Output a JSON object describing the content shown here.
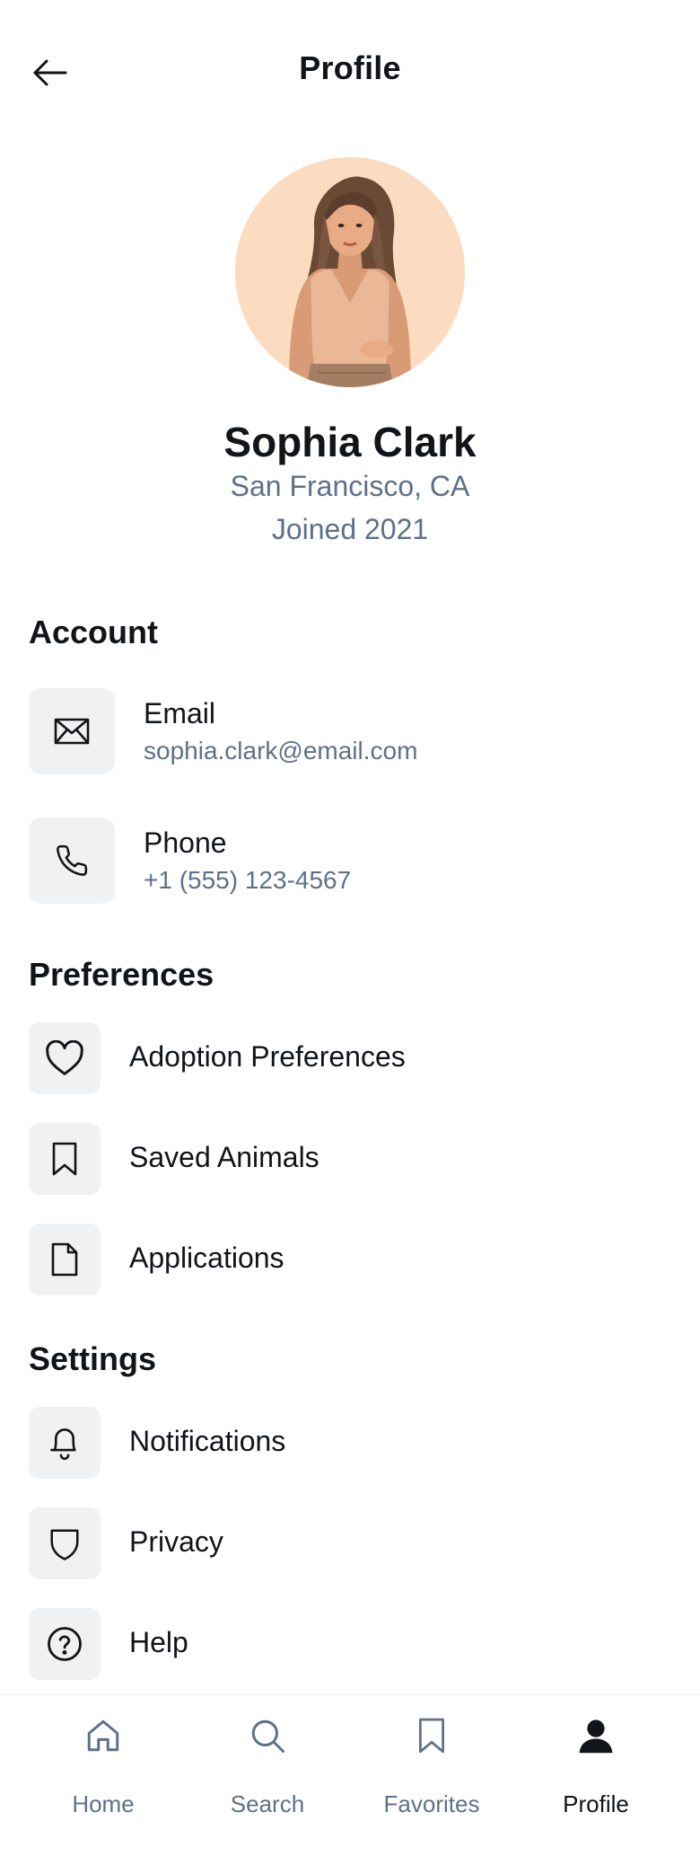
{
  "header": {
    "title": "Profile",
    "back_icon": "arrow-left-icon"
  },
  "profile": {
    "name": "Sophia Clark",
    "location": "San Francisco, CA",
    "joined": "Joined 2021",
    "avatar": "woman-portrait-illustration",
    "avatar_bg": "#fbdcc0"
  },
  "account": {
    "title": "Account",
    "items": [
      {
        "label": "Email",
        "value": "sophia.clark@email.com",
        "icon": "mail-icon"
      },
      {
        "label": "Phone",
        "value": "+1 (555) 123-4567",
        "icon": "phone-icon"
      }
    ]
  },
  "preferences": {
    "title": "Preferences",
    "items": [
      {
        "label": "Adoption Preferences",
        "icon": "heart-icon"
      },
      {
        "label": "Saved Animals",
        "icon": "bookmark-icon"
      },
      {
        "label": "Applications",
        "icon": "document-icon"
      }
    ]
  },
  "settings": {
    "title": "Settings",
    "items": [
      {
        "label": "Notifications",
        "icon": "bell-icon"
      },
      {
        "label": "Privacy",
        "icon": "shield-icon"
      },
      {
        "label": "Help",
        "icon": "help-circle-icon"
      }
    ]
  },
  "nav": {
    "items": [
      {
        "label": "Home",
        "icon": "home-icon",
        "active": false
      },
      {
        "label": "Search",
        "icon": "search-icon",
        "active": false
      },
      {
        "label": "Favorites",
        "icon": "bookmark-icon",
        "active": false
      },
      {
        "label": "Profile",
        "icon": "user-icon",
        "active": true
      }
    ]
  },
  "colors": {
    "text_primary": "#111418",
    "text_secondary": "#5f7089",
    "icon_tile": "#eff1f3",
    "divider": "#e6e8eb"
  }
}
